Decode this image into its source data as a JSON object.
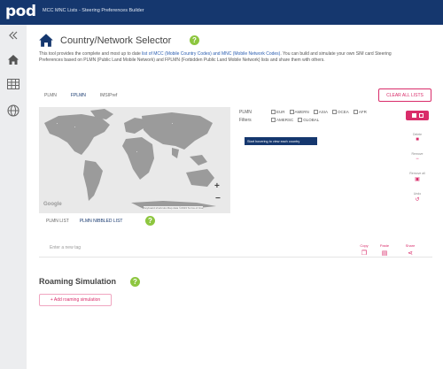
{
  "header": {
    "logo": "pod",
    "title": "MCC MNC Lists - Steering Preferences Builder"
  },
  "sidebar": {
    "items": [
      {
        "icon": "collapse-icon"
      },
      {
        "icon": "home-icon"
      },
      {
        "icon": "table-icon"
      },
      {
        "icon": "globe-icon"
      }
    ]
  },
  "page": {
    "title": "Country/Network Selector",
    "help": "?",
    "intro": {
      "pre": "This tool provides the complete and most up to date ",
      "link": "list of MCC (Mobile Country Codes) and MNC (Mobile Network Codes)",
      "post": ". You can build and simulate your own SIM card Steering Preferences based on PLMN (Public Land Mobile Network) and FPLMN (Forbidden Public Land Mobile Network) lists and share them with others."
    }
  },
  "tabs": [
    "PLMN",
    "FPLMN",
    "IMSIPref"
  ],
  "actions": {
    "clear_all": "CLEAR ALL LISTS"
  },
  "map": {
    "zoom_in": "+",
    "zoom_out": "−",
    "google_label": "Google",
    "credits": "Keyboard shortcuts   Map data ©2023   Terms of Use"
  },
  "regions": {
    "plmn_label": "PLMN",
    "filters_label": "Filters",
    "row1": [
      "EUR",
      "AMERN",
      "ASIA",
      "OCEA",
      "AFR"
    ],
    "row2": [
      "AMERSC",
      "GLOBAL"
    ]
  },
  "notice": "Start hovering to view each country",
  "side_actions": [
    {
      "label": "Delete",
      "icon": "trash-icon"
    },
    {
      "label": "Remove",
      "icon": "minus-icon"
    },
    {
      "label": "Remove all",
      "icon": "trash-all-icon"
    },
    {
      "label": "Undo",
      "icon": "undo-icon"
    }
  ],
  "list_tabs": [
    "PLMN LIST",
    "PLMN NIBBLED LIST"
  ],
  "tag_input": {
    "placeholder": "Enter a new tag"
  },
  "tools": [
    {
      "label": "Copy",
      "icon": "copy-icon"
    },
    {
      "label": "Paste",
      "icon": "paste-icon"
    },
    {
      "label": "Share",
      "icon": "share-icon"
    }
  ],
  "simulation": {
    "title": "Roaming Simulation",
    "add_button": "+ Add roaming simulation"
  },
  "colors": {
    "brand": "#15376e",
    "accent": "#d92c6a",
    "help": "#8dc63f"
  }
}
